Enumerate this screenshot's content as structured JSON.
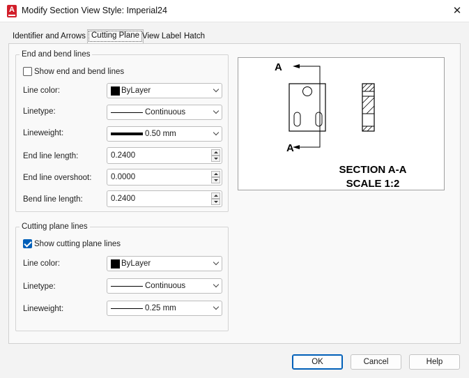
{
  "window": {
    "title": "Modify Section View Style: Imperial24",
    "app_icon_letter": "A",
    "close_glyph": "✕"
  },
  "tabs": [
    {
      "label": "Identifier and Arrows",
      "active": false
    },
    {
      "label": "Cutting Plane",
      "active": true
    },
    {
      "label": "View Label",
      "active": false
    },
    {
      "label": "Hatch",
      "active": false
    }
  ],
  "end_bend": {
    "title": "End and bend lines",
    "show_checkbox": {
      "label": "Show end and bend lines",
      "checked": false
    },
    "line_color": {
      "label": "Line color:",
      "value": "ByLayer"
    },
    "linetype": {
      "label": "Linetype:",
      "value": "Continuous"
    },
    "lineweight": {
      "label": "Lineweight:",
      "value": "0.50 mm"
    },
    "end_line_length": {
      "label": "End line length:",
      "value": "0.2400"
    },
    "end_line_overshoot": {
      "label": "End line overshoot:",
      "value": "0.0000"
    },
    "bend_line_length": {
      "label": "Bend line length:",
      "value": "0.2400"
    }
  },
  "cutting_plane": {
    "title": "Cutting plane lines",
    "show_checkbox": {
      "label": "Show cutting plane lines",
      "checked": true
    },
    "line_color": {
      "label": "Line color:",
      "value": "ByLayer"
    },
    "linetype": {
      "label": "Linetype:",
      "value": "Continuous"
    },
    "lineweight": {
      "label": "Lineweight:",
      "value": "0.25 mm"
    }
  },
  "preview": {
    "label_top": "A",
    "label_bottom": "A",
    "section_title": "SECTION A-A",
    "scale_text": "SCALE 1:2"
  },
  "buttons": {
    "ok": "OK",
    "cancel": "Cancel",
    "help": "Help"
  },
  "colors": {
    "accent": "#005fb8",
    "app_icon": "#d21f2b"
  }
}
